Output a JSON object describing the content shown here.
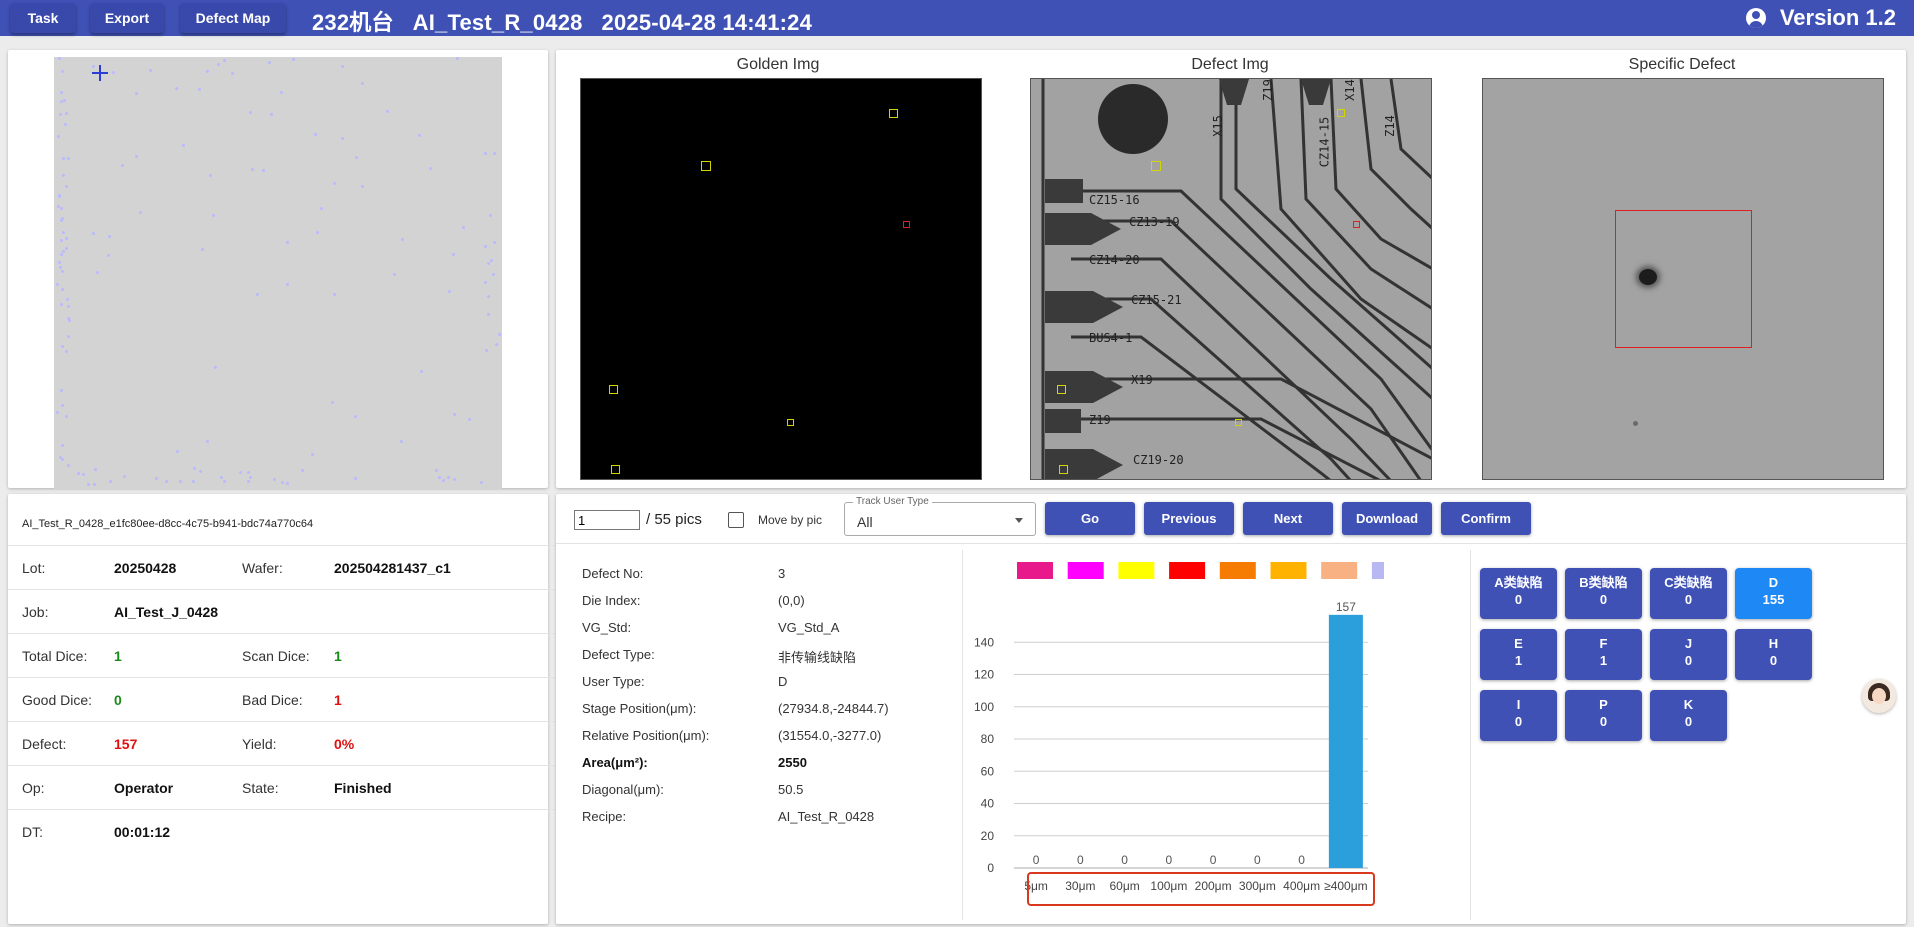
{
  "header": {
    "task_label": "Task",
    "export_label": "Export",
    "defect_map_label": "Defect Map",
    "title": "232机台   AI_Test_R_0428   2025-04-28 14:41:24",
    "version": "Version 1.2"
  },
  "images": {
    "golden_title": "Golden Img",
    "defect_title": "Defect Img",
    "specific_title": "Specific Defect",
    "circuit_labels": [
      "CZ15-16",
      "CZ13-19",
      "CZ14-20",
      "CZ15-21",
      "BUS4-1",
      "X19",
      "Z19",
      "CZ19-20",
      "X15",
      "CZ14-15",
      "Z14",
      "Z19",
      "X14"
    ]
  },
  "info": {
    "job_id": "AI_Test_R_0428_e1fc80ee-d8cc-4c75-b941-bdc74a770c64",
    "lot_label": "Lot:",
    "lot": "20250428",
    "wafer_label": "Wafer:",
    "wafer": "202504281437_c1",
    "job_label": "Job:",
    "job": "AI_Test_J_0428",
    "total_dice_label": "Total Dice:",
    "total_dice": "1",
    "scan_dice_label": "Scan Dice:",
    "scan_dice": "1",
    "good_dice_label": "Good Dice:",
    "good_dice": "0",
    "bad_dice_label": "Bad Dice:",
    "bad_dice": "1",
    "defect_label": "Defect:",
    "defect": "157",
    "yield_label": "Yield:",
    "yield": "0%",
    "op_label": "Op:",
    "op": "Operator",
    "state_label": "State:",
    "state": "Finished",
    "dt_label": "DT:",
    "dt": "00:01:12"
  },
  "toolbar": {
    "page_value": "1",
    "page_total": "/ 55 pics",
    "move_by_pic_label": "Move by pic",
    "track_legend": "Track User Type",
    "track_value": "All",
    "go_label": "Go",
    "previous_label": "Previous",
    "next_label": "Next",
    "download_label": "Download",
    "confirm_label": "Confirm"
  },
  "defect": {
    "rows": [
      {
        "label": "Defect No:",
        "value": "3"
      },
      {
        "label": "Die Index:",
        "value": "(0,0)"
      },
      {
        "label": "VG_Std:",
        "value": "VG_Std_A"
      },
      {
        "label": "Defect Type:",
        "value": "非传输线缺陷"
      },
      {
        "label": "User Type:",
        "value": "D"
      },
      {
        "label": "Stage Position(μm):",
        "value": "(27934.8,-24844.7)"
      },
      {
        "label": "Relative Position(μm):",
        "value": "(31554.0,-3277.0)"
      },
      {
        "label": "Area(μm²):",
        "value": "2550"
      },
      {
        "label": "Diagonal(μm):",
        "value": "50.5"
      },
      {
        "label": "Recipe:",
        "value": "AI_Test_R_0428"
      }
    ]
  },
  "chart_data": {
    "type": "bar",
    "categories": [
      "5μm",
      "30μm",
      "60μm",
      "100μm",
      "200μm",
      "300μm",
      "400μm",
      "≥400μm"
    ],
    "values": [
      0,
      0,
      0,
      0,
      0,
      0,
      0,
      157
    ],
    "legend_colors": [
      "#e8198b",
      "#ff00ff",
      "#ffff00",
      "#ff0000",
      "#f57c00",
      "#ffb300",
      "#f7b183",
      "#b8b8f2"
    ],
    "bar_color": "#2b9fdb",
    "yticks": [
      0,
      20,
      40,
      60,
      80,
      100,
      120,
      140
    ],
    "ylim": [
      0,
      160
    ],
    "grid": true
  },
  "classes": [
    {
      "name": "A类缺陷",
      "count": "0",
      "active": false
    },
    {
      "name": "B类缺陷",
      "count": "0",
      "active": false
    },
    {
      "name": "C类缺陷",
      "count": "0",
      "active": false
    },
    {
      "name": "D",
      "count": "155",
      "active": true
    },
    {
      "name": "E",
      "count": "1",
      "active": false
    },
    {
      "name": "F",
      "count": "1",
      "active": false
    },
    {
      "name": "J",
      "count": "0",
      "active": false
    },
    {
      "name": "H",
      "count": "0",
      "active": false
    },
    {
      "name": "I",
      "count": "0",
      "active": false
    },
    {
      "name": "P",
      "count": "0",
      "active": false
    },
    {
      "name": "K",
      "count": "0",
      "active": false
    }
  ],
  "colors": {
    "header_bg": "#3f51b5",
    "button_bg": "#3f51b5",
    "active_button_bg": "#1e88f5",
    "highlight_border": "#d9381e"
  }
}
